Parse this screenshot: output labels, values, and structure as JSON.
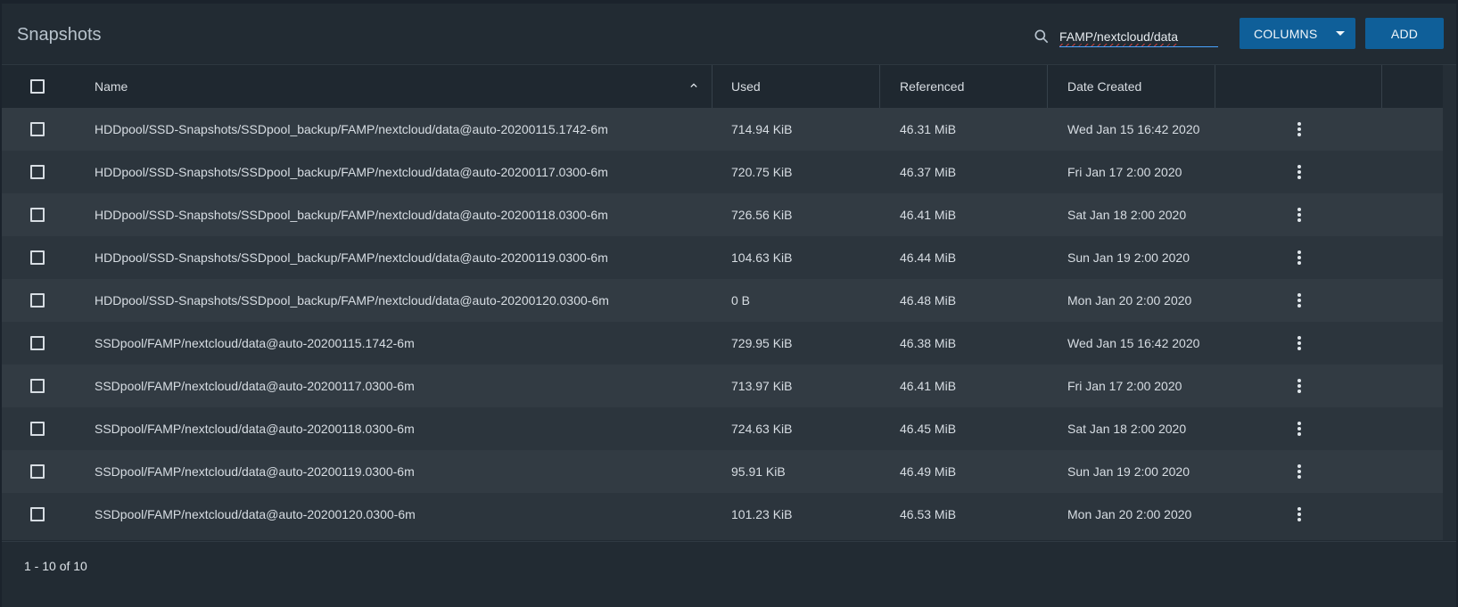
{
  "window": {
    "title": "Snapshots"
  },
  "toolbar": {
    "search_value": "FAMP/nextcloud/data",
    "columns_label": "COLUMNS",
    "add_label": "ADD"
  },
  "table": {
    "headers": {
      "name": "Name",
      "used": "Used",
      "referenced": "Referenced",
      "date_created": "Date Created"
    },
    "rows": [
      {
        "name": "HDDpool/SSD-Snapshots/SSDpool_backup/FAMP/nextcloud/data@auto-20200115.1742-6m",
        "used": "714.94 KiB",
        "referenced": "46.31 MiB",
        "date_created": "Wed Jan 15 16:42 2020"
      },
      {
        "name": "HDDpool/SSD-Snapshots/SSDpool_backup/FAMP/nextcloud/data@auto-20200117.0300-6m",
        "used": "720.75 KiB",
        "referenced": "46.37 MiB",
        "date_created": "Fri Jan 17 2:00 2020"
      },
      {
        "name": "HDDpool/SSD-Snapshots/SSDpool_backup/FAMP/nextcloud/data@auto-20200118.0300-6m",
        "used": "726.56 KiB",
        "referenced": "46.41 MiB",
        "date_created": "Sat Jan 18 2:00 2020"
      },
      {
        "name": "HDDpool/SSD-Snapshots/SSDpool_backup/FAMP/nextcloud/data@auto-20200119.0300-6m",
        "used": "104.63 KiB",
        "referenced": "46.44 MiB",
        "date_created": "Sun Jan 19 2:00 2020"
      },
      {
        "name": "HDDpool/SSD-Snapshots/SSDpool_backup/FAMP/nextcloud/data@auto-20200120.0300-6m",
        "used": "0 B",
        "referenced": "46.48 MiB",
        "date_created": "Mon Jan 20 2:00 2020"
      },
      {
        "name": "SSDpool/FAMP/nextcloud/data@auto-20200115.1742-6m",
        "used": "729.95 KiB",
        "referenced": "46.38 MiB",
        "date_created": "Wed Jan 15 16:42 2020"
      },
      {
        "name": "SSDpool/FAMP/nextcloud/data@auto-20200117.0300-6m",
        "used": "713.97 KiB",
        "referenced": "46.41 MiB",
        "date_created": "Fri Jan 17 2:00 2020"
      },
      {
        "name": "SSDpool/FAMP/nextcloud/data@auto-20200118.0300-6m",
        "used": "724.63 KiB",
        "referenced": "46.45 MiB",
        "date_created": "Sat Jan 18 2:00 2020"
      },
      {
        "name": "SSDpool/FAMP/nextcloud/data@auto-20200119.0300-6m",
        "used": "95.91 KiB",
        "referenced": "46.49 MiB",
        "date_created": "Sun Jan 19 2:00 2020"
      },
      {
        "name": "SSDpool/FAMP/nextcloud/data@auto-20200120.0300-6m",
        "used": "101.23 KiB",
        "referenced": "46.53 MiB",
        "date_created": "Mon Jan 20 2:00 2020"
      }
    ]
  },
  "footer": {
    "pagination_text": "1 - 10 of 10"
  },
  "icons": {
    "search": "search-icon",
    "sort": "sort-ascending-icon",
    "actions": "kebab-menu-icon",
    "dropdown": "chevron-down-icon"
  },
  "colors": {
    "accent": "#0f5f99",
    "background": "#222b33",
    "row_alt": "#323b43",
    "row_base": "#2c353d"
  }
}
